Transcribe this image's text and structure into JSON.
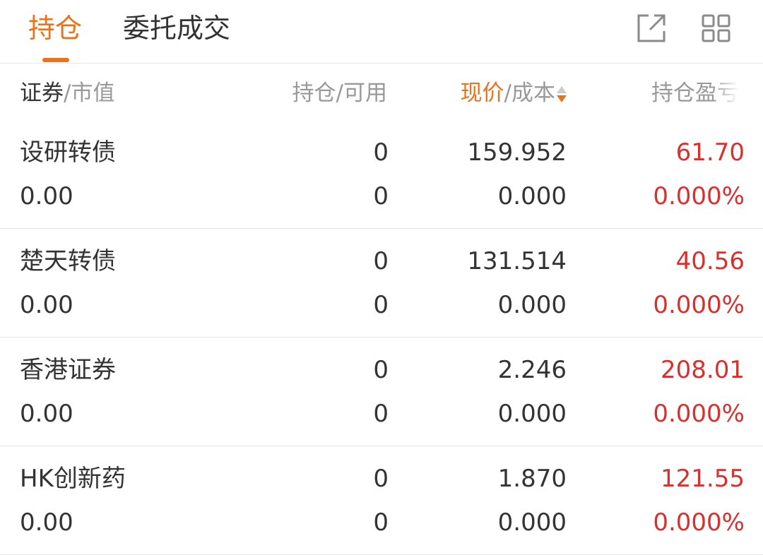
{
  "tabs": [
    {
      "label": "持仓",
      "active": true
    },
    {
      "label": "委托成交",
      "active": false
    }
  ],
  "icons": {
    "external": "external-link-icon",
    "grid": "grid-apps-icon"
  },
  "header": {
    "col1_main": "证券",
    "col1_sep": "/市值",
    "col2": "持仓/可用",
    "col3_main": "现价",
    "col3_sep": "/成本",
    "col4": "持仓盈亏"
  },
  "colors": {
    "accent": "#e8731c",
    "loss_profit_red": "#d8302f",
    "text": "#333333",
    "muted": "#999999"
  },
  "positions": [
    {
      "name": "设研转债",
      "market_value": "0.00",
      "holding": "0",
      "available": "0",
      "price": "159.952",
      "cost": "0.000",
      "pl": "61.70",
      "pl_pct": "0.000%"
    },
    {
      "name": "楚天转债",
      "market_value": "0.00",
      "holding": "0",
      "available": "0",
      "price": "131.514",
      "cost": "0.000",
      "pl": "40.56",
      "pl_pct": "0.000%"
    },
    {
      "name": "香港证券",
      "market_value": "0.00",
      "holding": "0",
      "available": "0",
      "price": "2.246",
      "cost": "0.000",
      "pl": "208.01",
      "pl_pct": "0.000%"
    },
    {
      "name": "HK创新药",
      "market_value": "0.00",
      "holding": "0",
      "available": "0",
      "price": "1.870",
      "cost": "0.000",
      "pl": "121.55",
      "pl_pct": "0.000%"
    }
  ]
}
